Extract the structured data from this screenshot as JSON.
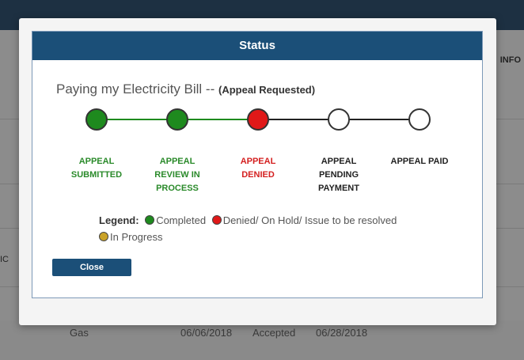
{
  "background": {
    "column_header": "INFO",
    "cut_text": "IC",
    "row": {
      "utility": "Gas",
      "date1": "06/06/2018",
      "status": "Accepted",
      "date2": "06/28/2018"
    }
  },
  "modal": {
    "title": "Status",
    "bill_name": "Paying my Electricity Bill --",
    "bill_status": "(Appeal Requested)",
    "steps": [
      {
        "label_lines": [
          "APPEAL",
          "SUBMITTED"
        ],
        "state": "completed"
      },
      {
        "label_lines": [
          "APPEAL",
          "REVIEW IN",
          "PROCESS"
        ],
        "state": "completed"
      },
      {
        "label_lines": [
          "APPEAL",
          "DENIED"
        ],
        "state": "denied"
      },
      {
        "label_lines": [
          "APPEAL",
          "PENDING",
          "PAYMENT"
        ],
        "state": "pending"
      },
      {
        "label_lines": [
          "APPEAL PAID"
        ],
        "state": "pending"
      }
    ],
    "legend": {
      "key": "Legend:",
      "completed": "Completed",
      "denied": "Denied/ On Hold/ Issue to be resolved",
      "in_progress": "In Progress"
    },
    "close_label": "Close"
  },
  "colors": {
    "completed": "#1e8a1e",
    "denied": "#e01818",
    "in_progress": "#c9a227",
    "pending": "#ffffff",
    "completed_text": "#2a8a2a",
    "denied_text": "#d42020",
    "pending_text": "#222222",
    "header": "#1b4f78"
  }
}
